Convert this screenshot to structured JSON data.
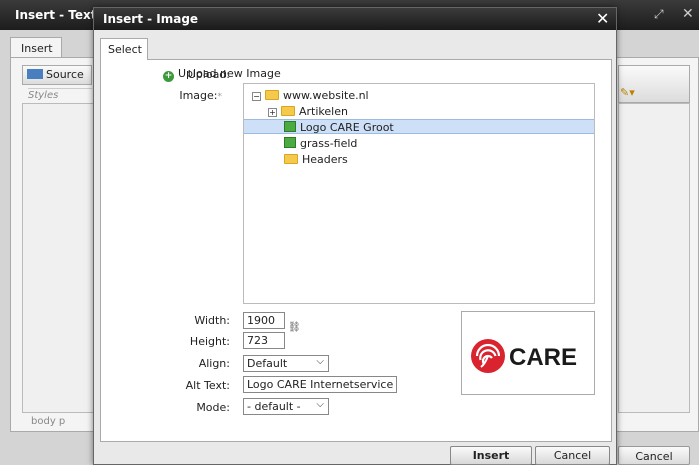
{
  "background_dialog": {
    "title": "Insert - Text",
    "tab": "Insert",
    "source_button": "Source",
    "styles_placeholder": "Styles",
    "element_path": "body  p",
    "cancel_label": "Cancel"
  },
  "dialog": {
    "title": "Insert - Image",
    "close_glyph": "✕",
    "tab": "Select",
    "upload_label": "Upload:",
    "upload_link": "Upload new Image",
    "image_label": "Image:",
    "required_mark": "*",
    "tree": {
      "root": "www.website.nl",
      "items": [
        {
          "label": "Artikelen",
          "type": "folder",
          "expandable": true
        },
        {
          "label": "Logo CARE Groot",
          "type": "image",
          "selected": true
        },
        {
          "label": "grass-field",
          "type": "image"
        },
        {
          "label": "Headers",
          "type": "folder"
        }
      ]
    },
    "width_label": "Width:",
    "width_value": "1900",
    "height_label": "Height:",
    "height_value": "723",
    "align_label": "Align:",
    "align_value": "Default",
    "alt_label": "Alt Text:",
    "alt_value": "Logo CARE Internetservice",
    "mode_label": "Mode:",
    "mode_value": "- default -",
    "preview_logo_text": "CARE",
    "insert_label": "Insert",
    "cancel_label": "Cancel"
  },
  "colors": {
    "titlebar": "#2a2a2a",
    "selection": "#cde0f7",
    "logo_red": "#d9232e"
  }
}
